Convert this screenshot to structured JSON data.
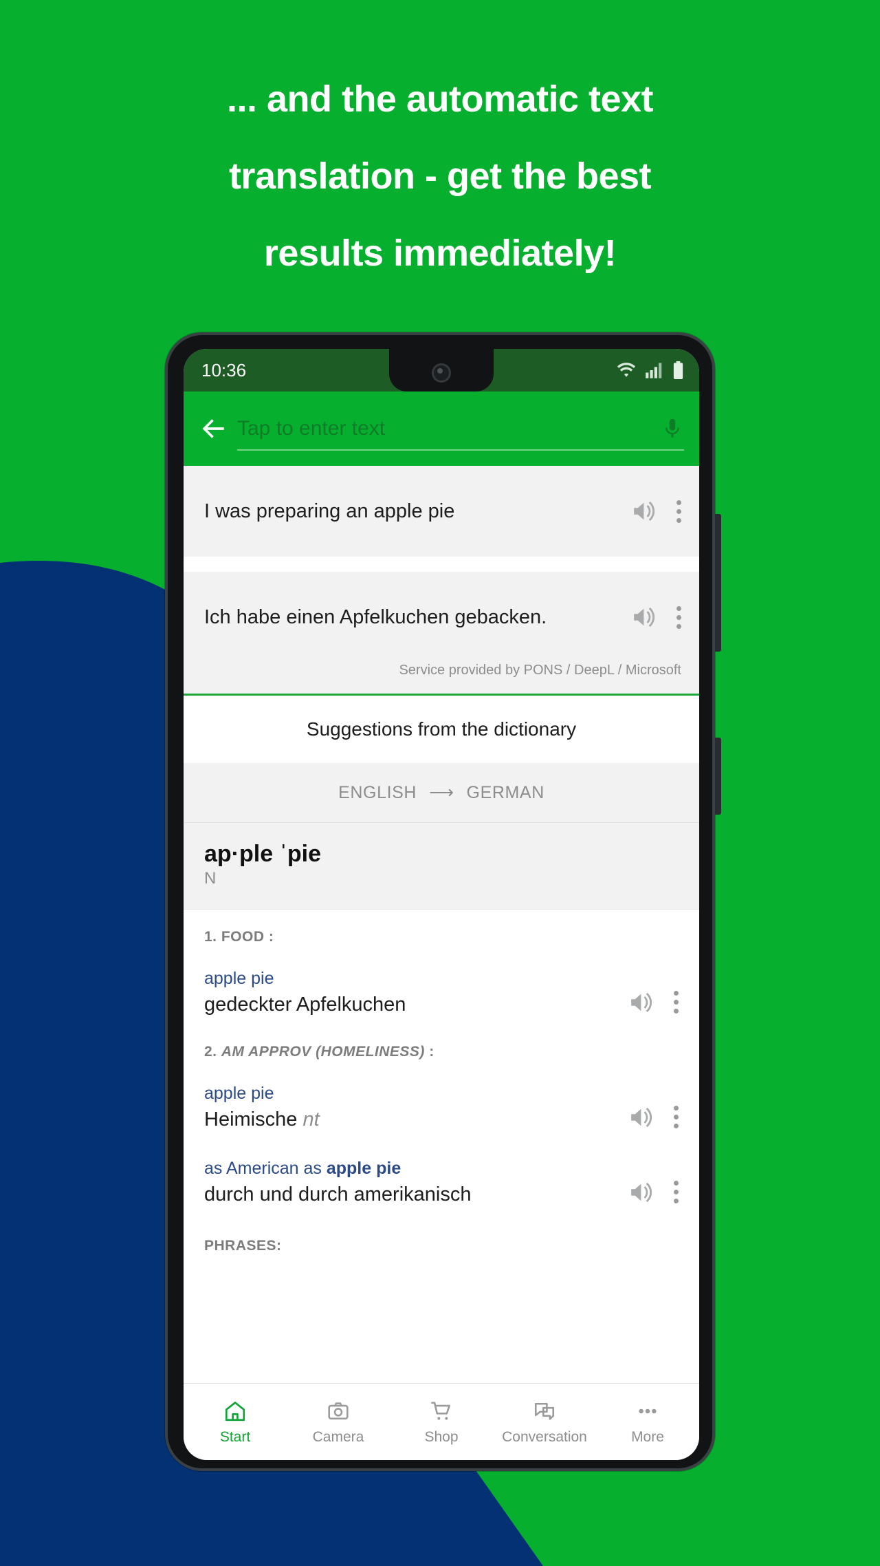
{
  "colors": {
    "brand_green": "#06b02e",
    "dark_navy": "#043174",
    "status_bar_green": "#1d5c24",
    "accent_green": "#11a436",
    "link_blue": "#2b4a86"
  },
  "headline": {
    "lines": [
      "... and the automatic text",
      "translation - get the best",
      "results immediately!"
    ]
  },
  "phone": {
    "status_bar": {
      "time": "10:36",
      "icons": [
        "wifi-icon",
        "signal-icon",
        "battery-icon"
      ]
    },
    "app_bar": {
      "back_icon": "back-arrow-icon",
      "search_placeholder": "Tap to enter text",
      "search_value": "",
      "mic_icon": "microphone-icon"
    },
    "translation": {
      "source_text": "I was preparing an apple pie",
      "target_text": "Ich habe einen Apfelkuchen gebacken.",
      "service_note": "Service provided by PONS / DeepL / Microsoft",
      "speaker_icon": "speaker-icon",
      "menu_icon": "overflow-menu-icon"
    },
    "dictionary": {
      "suggestions_title": "Suggestions from the dictionary",
      "lang_from": "ENGLISH",
      "lang_arrow": "⟶",
      "lang_to": "GERMAN",
      "headword": "ap·ple ˈpie",
      "part_of_speech": "N",
      "senses": [
        {
          "label_num": "1.",
          "label_text": "FOOD",
          "label_italic": false,
          "label_suffix": ":",
          "entries": [
            {
              "source": "apple pie",
              "source_bold": "",
              "target": "gedeckter Apfelkuchen",
              "target_italic": ""
            }
          ]
        },
        {
          "label_num": "2.",
          "label_text": "AM APPROV (HOMELINESS)",
          "label_italic": true,
          "label_suffix": ":",
          "entries": [
            {
              "source": "apple pie",
              "source_bold": "",
              "target": "Heimische ",
              "target_italic": "nt"
            },
            {
              "source": "as American as ",
              "source_bold": "apple pie",
              "target": "durch und durch amerikanisch",
              "target_italic": ""
            }
          ]
        }
      ],
      "phrases_label": "PHRASES:"
    },
    "bottom_nav": [
      {
        "label": "Start",
        "icon": "home-icon",
        "active": true
      },
      {
        "label": "Camera",
        "icon": "camera-icon",
        "active": false
      },
      {
        "label": "Shop",
        "icon": "cart-icon",
        "active": false
      },
      {
        "label": "Conversation",
        "icon": "chat-icon",
        "active": false
      },
      {
        "label": "More",
        "icon": "more-dots-icon",
        "active": false
      }
    ]
  }
}
